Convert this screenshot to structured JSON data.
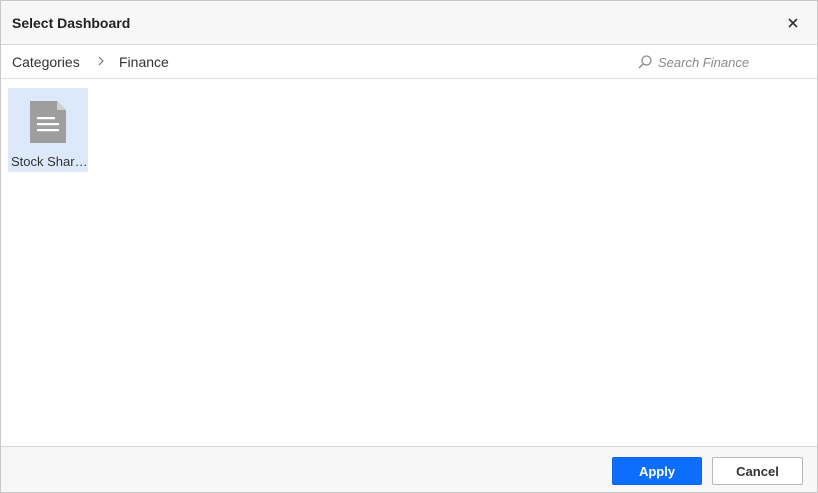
{
  "dialog": {
    "title": "Select Dashboard",
    "close_icon": "close-icon"
  },
  "breadcrumb": {
    "root": "Categories",
    "separator_icon": "chevron-right-icon",
    "current": "Finance"
  },
  "search": {
    "icon": "search-icon",
    "placeholder": "Search Finance",
    "value": ""
  },
  "items": [
    {
      "label": "Stock Shar…",
      "icon": "document-icon",
      "selected": true
    }
  ],
  "footer": {
    "apply_label": "Apply",
    "cancel_label": "Cancel"
  },
  "colors": {
    "accent": "#0d6efd",
    "selection": "#dbe9fb",
    "icon_gray": "#9e9e9e"
  }
}
